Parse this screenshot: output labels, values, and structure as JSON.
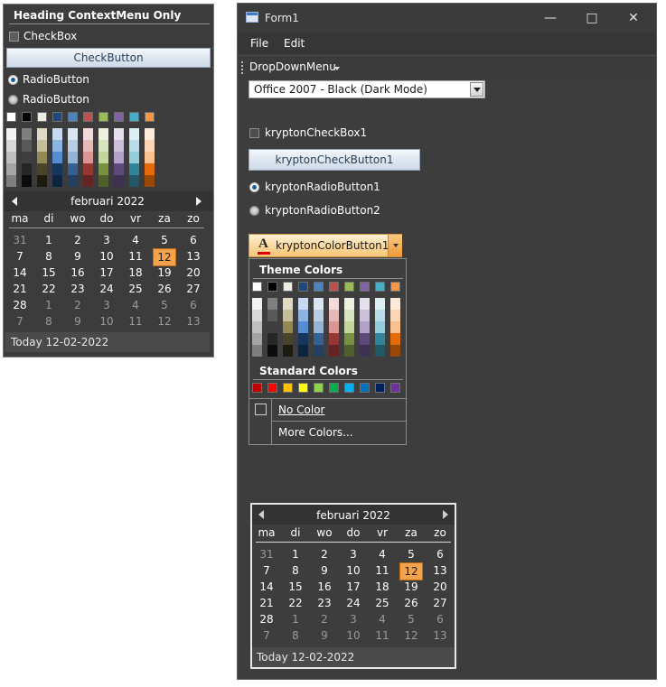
{
  "context_menu": {
    "heading": "Heading ContextMenu Only",
    "checkbox_label": "CheckBox",
    "checkbutton_label": "CheckButton",
    "radio1_label": "RadioButton",
    "radio2_label": "RadioButton",
    "calendar": {
      "month_label": "februari 2022",
      "today_label": "Today 12-02-2022"
    }
  },
  "window": {
    "title": "Form1",
    "menu": {
      "file": "File",
      "edit": "Edit"
    },
    "toolbar": {
      "dropdown_label": "DropDownMenu"
    },
    "theme_combo_value": "Office 2007 - Black (Dark Mode)",
    "checkbox_label": "kryptonCheckBox1",
    "checkbutton_label": "kryptonCheckButton1",
    "radio1_label": "kryptonRadioButton1",
    "radio2_label": "kryptonRadioButton2",
    "color_button_label": "kryptonColorButton1",
    "color_popup": {
      "theme_colors_heading": "Theme Colors",
      "standard_colors_heading": "Standard Colors",
      "no_color_label": "No Color",
      "more_colors_label": "More Colors..."
    },
    "calendar": {
      "month_label": "februari 2022",
      "today_label": "Today 12-02-2022"
    }
  },
  "calendar_days": {
    "headers": [
      "ma",
      "di",
      "wo",
      "do",
      "vr",
      "za",
      "zo"
    ],
    "weeks": [
      [
        "31",
        "1",
        "2",
        "3",
        "4",
        "5",
        "6"
      ],
      [
        "7",
        "8",
        "9",
        "10",
        "11",
        "12",
        "13"
      ],
      [
        "14",
        "15",
        "16",
        "17",
        "18",
        "19",
        "20"
      ],
      [
        "21",
        "22",
        "23",
        "24",
        "25",
        "26",
        "27"
      ],
      [
        "28",
        "1",
        "2",
        "3",
        "4",
        "5",
        "6"
      ],
      [
        "7",
        "8",
        "9",
        "10",
        "11",
        "12",
        "13"
      ]
    ],
    "selected_day": "12"
  },
  "colors": {
    "accent": "#f4a24b",
    "window_bg": "#3d3d3d",
    "theme_top": [
      "#ffffff",
      "#000000",
      "#eeece1",
      "#1f497d",
      "#4f81bd",
      "#c0504d",
      "#9bbb59",
      "#8064a2",
      "#4bacc6",
      "#f79646"
    ],
    "theme_shades": [
      [
        "#f2f2f2",
        "#d8d8d8",
        "#bfbfbf",
        "#a5a5a5",
        "#7f7f7f"
      ],
      [
        "#7f7f7f",
        "#595959",
        "#3f3f3f",
        "#262626",
        "#0c0c0c"
      ],
      [
        "#ddd9c3",
        "#c4bd97",
        "#938953",
        "#494429",
        "#1d1b10"
      ],
      [
        "#c6d9f0",
        "#8db3e2",
        "#548dd4",
        "#17365d",
        "#0f243e"
      ],
      [
        "#dbe5f1",
        "#b8cce4",
        "#95b3d7",
        "#366092",
        "#244061"
      ],
      [
        "#f2dcdb",
        "#e5b9b7",
        "#d99694",
        "#953734",
        "#632423"
      ],
      [
        "#ebf1dd",
        "#d7e3bc",
        "#c3d69b",
        "#76923c",
        "#4f6128"
      ],
      [
        "#e5e0ec",
        "#ccc1d9",
        "#b2a2c7",
        "#5f497a",
        "#3f3151"
      ],
      [
        "#dbeef3",
        "#b7dde8",
        "#92cddc",
        "#31859b",
        "#205867"
      ],
      [
        "#fdeada",
        "#fbd5b5",
        "#fac08f",
        "#e36c09",
        "#974806"
      ]
    ],
    "standard": [
      "#c00000",
      "#ff0000",
      "#ffc000",
      "#ffff00",
      "#92d050",
      "#00b050",
      "#00b0f0",
      "#0070c0",
      "#002060",
      "#7030a0"
    ]
  }
}
